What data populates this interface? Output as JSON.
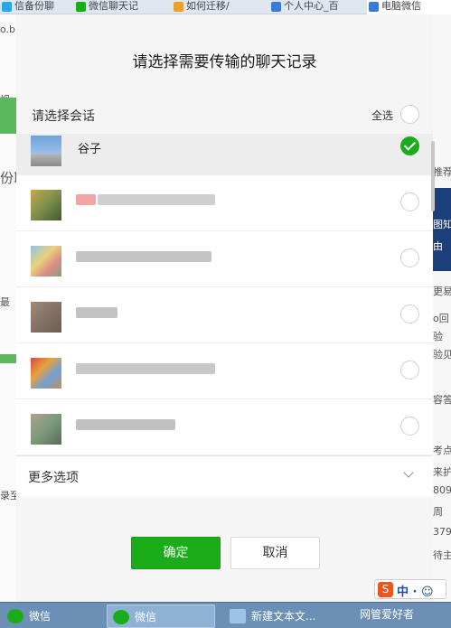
{
  "browser_tabs": [
    {
      "label": "信备份聊",
      "color": "#2aa5e6",
      "active": false
    },
    {
      "label": "微信聊天记",
      "color": "#1aad19",
      "active": false
    },
    {
      "label": "如何迁移/",
      "color": "#e8a12a",
      "active": false
    },
    {
      "label": "个人中心_百",
      "color": "#3a7bd5",
      "active": false
    },
    {
      "label": "电脑微信",
      "color": "#3a7bd5",
      "active": true
    }
  ],
  "background_fragments": {
    "left": [
      "o.b",
      "视",
      "份耶",
      "最",
      "录至"
    ],
    "right": [
      "推荐",
      "图知",
      "由",
      "更易",
      "o回",
      "验",
      "验见",
      "容答",
      "考点",
      "来护",
      "809",
      "周",
      "379",
      "待主"
    ]
  },
  "dialog": {
    "title": "请选择需要传输的聊天记录",
    "select_label": "请选择会话",
    "select_all_label": "全选",
    "conversations": [
      {
        "name": "谷子",
        "selected": true
      },
      {
        "name": "",
        "selected": false
      },
      {
        "name": "",
        "selected": false
      },
      {
        "name": "",
        "selected": false
      },
      {
        "name": "",
        "selected": false
      },
      {
        "name": "",
        "selected": false
      }
    ],
    "more_options_label": "更多选项",
    "confirm_label": "确定",
    "cancel_label": "取消"
  },
  "taskbar": {
    "items": [
      {
        "label": "微信",
        "active": false
      },
      {
        "label": "微信",
        "active": true
      },
      {
        "label": "新建文本文...",
        "active": false
      }
    ],
    "watermark": "网管爱好者"
  },
  "ime": {
    "logo": "S",
    "text": "中 · ☺"
  },
  "colors": {
    "accent": "#1aad19",
    "taskbar": "#6b8fb5"
  }
}
